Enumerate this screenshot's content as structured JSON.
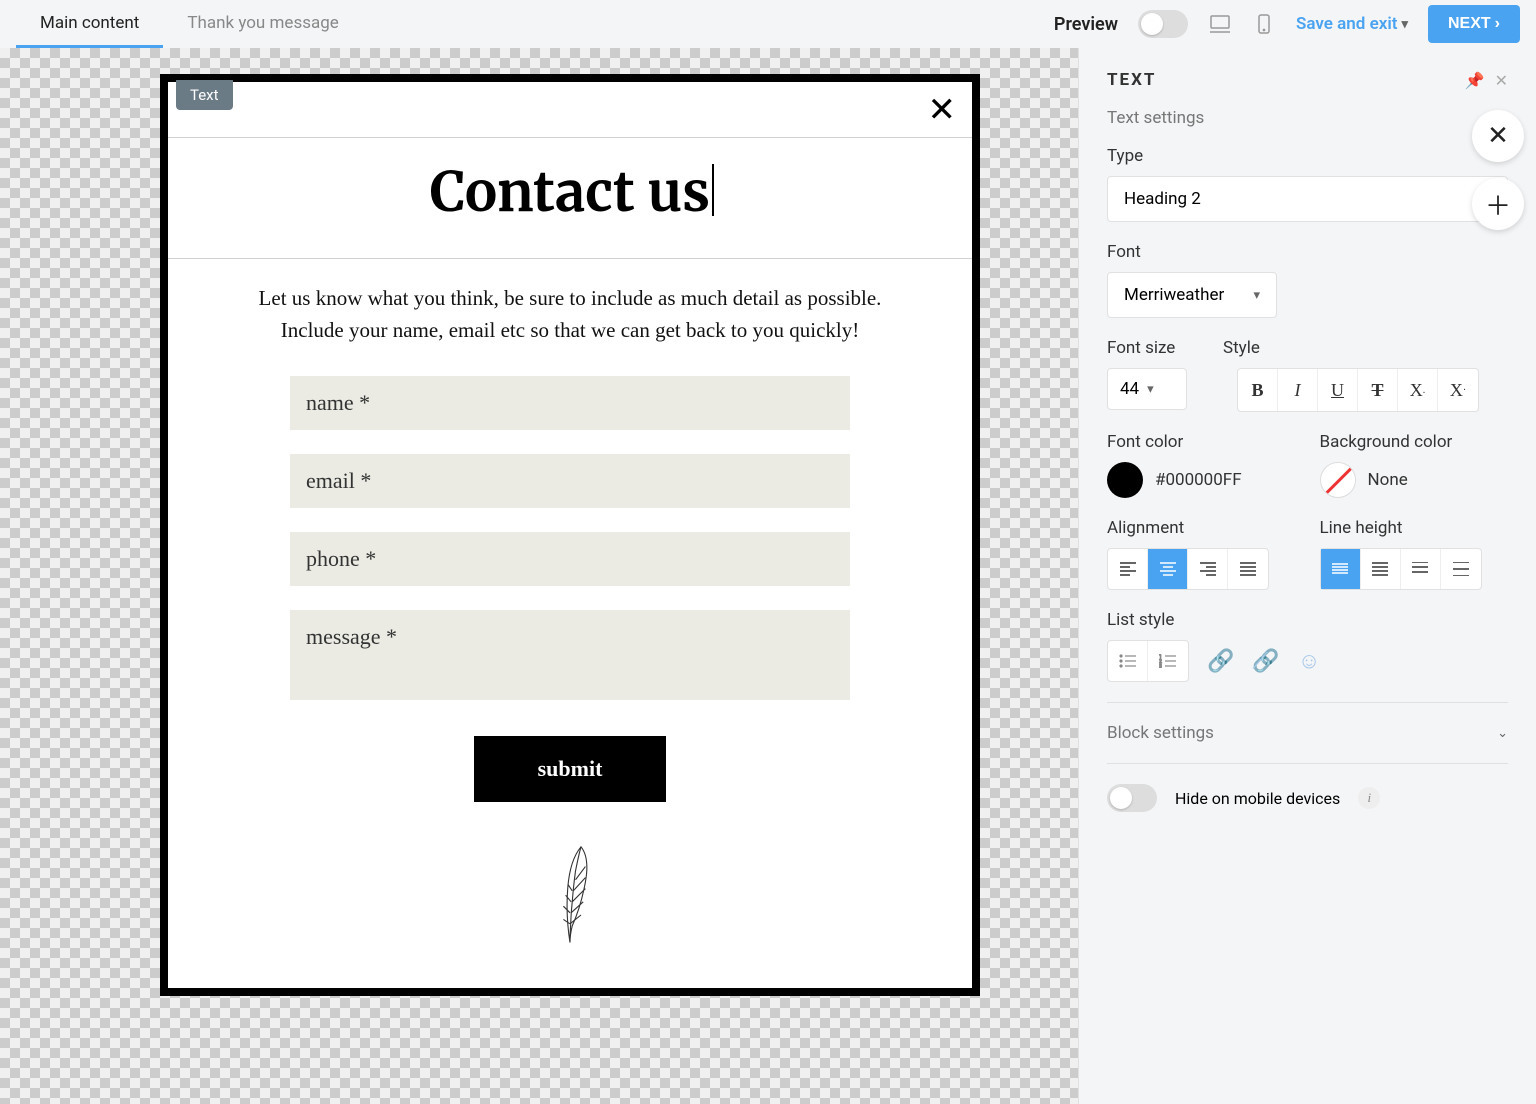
{
  "tabs": {
    "main": "Main content",
    "thank": "Thank you message"
  },
  "topbar": {
    "preview": "Preview",
    "save": "Save and exit",
    "next": "NEXT"
  },
  "popup": {
    "badge": "Text",
    "title": "Contact us",
    "desc": "Let us know what you think, be sure to include as much detail as possible. Include your name, email etc so that we can get back to you quickly!",
    "fields": {
      "name": "name *",
      "email": "email *",
      "phone": "phone *",
      "message": "message *"
    },
    "submit": "submit"
  },
  "panel": {
    "title": "TEXT",
    "text_settings": "Text settings",
    "type_label": "Type",
    "type_value": "Heading 2",
    "font_label": "Font",
    "font_value": "Merriweather",
    "font_size_label": "Font size",
    "font_size_value": "44",
    "style_label": "Style",
    "font_color_label": "Font color",
    "font_color_value": "#000000FF",
    "bg_color_label": "Background color",
    "bg_color_value": "None",
    "alignment_label": "Alignment",
    "line_height_label": "Line height",
    "list_label": "List style",
    "block_settings": "Block settings",
    "hide_mobile": "Hide on mobile devices"
  }
}
